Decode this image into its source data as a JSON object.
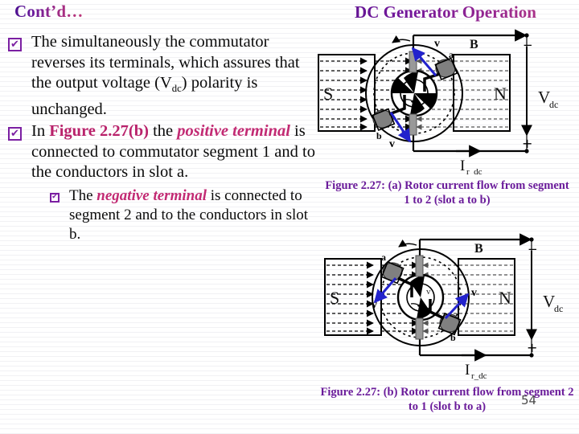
{
  "header": {
    "contd_label": "Cont’d…",
    "slide_heading": "DC Generator Operation"
  },
  "colors": {
    "heading_purple": "#6a1b9a",
    "accent_crimson": "#b9226b",
    "bullet_purple": "#7b1fa2",
    "arrow_blue": "#2222cc",
    "body_text": "#0a0a0a"
  },
  "bullets": [
    {
      "level": 1,
      "marker": "checked-box",
      "segments": [
        {
          "text": "The simultaneously the commutator reverses its terminals, which assures that the output voltage (V",
          "style": "plain"
        },
        {
          "text": "dc",
          "style": "subscript"
        },
        {
          "text": ") polarity is unchanged.",
          "style": "plain"
        }
      ]
    },
    {
      "level": 1,
      "marker": "checked-box",
      "segments": [
        {
          "text": "In ",
          "style": "plain"
        },
        {
          "text": "Figure 2.27(b)",
          "style": "emphasis-figure"
        },
        {
          "text": " the ",
          "style": "plain"
        },
        {
          "text": "positive terminal",
          "style": "emphasis-term"
        },
        {
          "text": " is connected to commutator segment 1 and to the conductors in slot a.",
          "style": "plain"
        }
      ]
    },
    {
      "level": 2,
      "marker": "checked-box-small",
      "segments": [
        {
          "text": "The ",
          "style": "plain"
        },
        {
          "text": "negative terminal",
          "style": "emphasis-term"
        },
        {
          "text": " is connected to segment 2 and to the conductors in slot b.",
          "style": "plain"
        }
      ]
    }
  ],
  "figures": [
    {
      "id": "figure-a",
      "caption": "Figure 2.27: (a)  Rotor current flow from segment 1 to 2 (slot a to b)",
      "labels": {
        "south_pole": "S",
        "north_pole": "N",
        "flux_density": "B",
        "velocity_top": "v",
        "velocity_bottom": "v",
        "slot_a": "a",
        "slot_b": "b",
        "output_voltage": "V",
        "output_voltage_sub": "dc",
        "rotor_current": "I",
        "rotor_current_sub": "r_dc",
        "terminal_negative": "−",
        "terminal_positive": "+"
      },
      "slot_a_position": "top-right",
      "slot_b_position": "bottom-left"
    },
    {
      "id": "figure-b",
      "caption": "Figure 2.27: (b)  Rotor current flow from segment 2 to 1 (slot b to a)",
      "labels": {
        "south_pole": "S",
        "north_pole": "N",
        "flux_density": "B",
        "velocity_top": "v",
        "velocity_bottom": "v",
        "slot_a": "a",
        "slot_b": "b",
        "output_voltage": "V",
        "output_voltage_sub": "dc",
        "rotor_current": "I",
        "rotor_current_sub": "r_dc",
        "terminal_negative": "−",
        "terminal_positive": "+"
      },
      "slot_a_position": "top-left",
      "slot_b_position": "bottom-right"
    }
  ],
  "page_number": "54"
}
